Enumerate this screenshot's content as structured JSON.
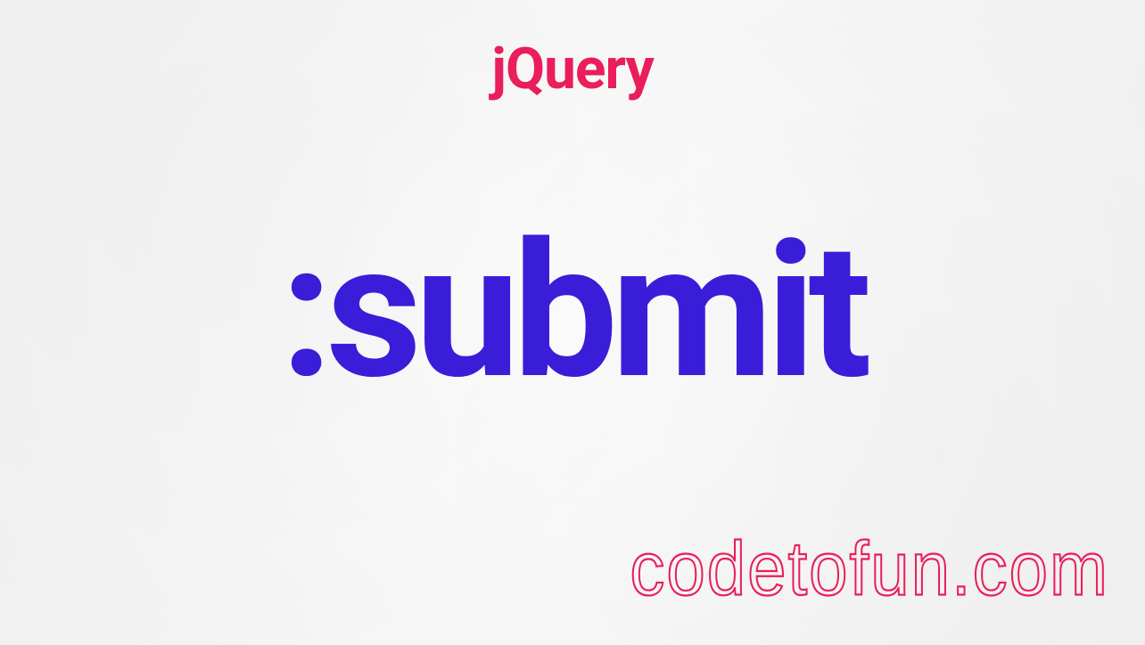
{
  "header": {
    "title": "jQuery"
  },
  "main": {
    "selector": ":submit"
  },
  "footer": {
    "brand": "codetofun.com"
  },
  "colors": {
    "accent_pink": "#e91e5a",
    "accent_blue": "#3a1dd8",
    "background": "#f1f1f1"
  }
}
